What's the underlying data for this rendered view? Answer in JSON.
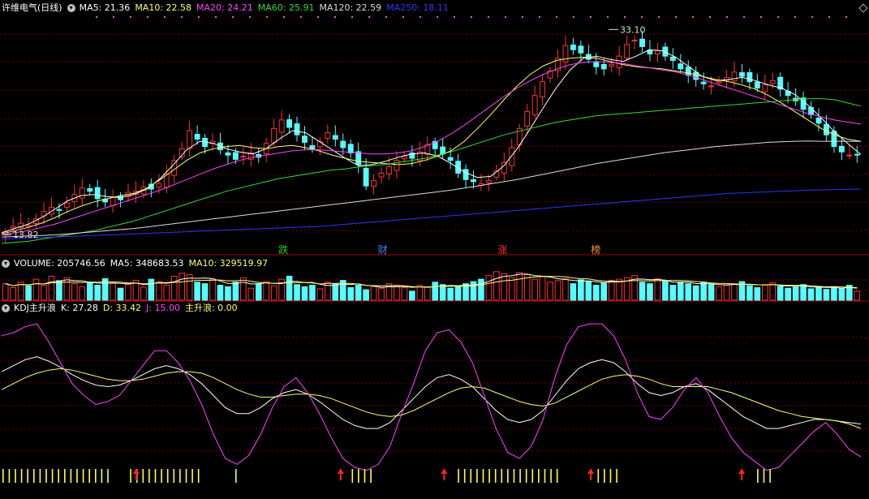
{
  "stock": {
    "name": "许维电气",
    "period": "(日线)",
    "title_color": "#ffffff"
  },
  "kline": {
    "toggle": "▾",
    "ma_labels": [
      {
        "name": "MA5",
        "value": "21.36",
        "color": "#ffffff"
      },
      {
        "name": "MA10",
        "value": "22.58",
        "color": "#ffff66"
      },
      {
        "name": "MA20",
        "value": "24.21",
        "color": "#ff44ff"
      },
      {
        "name": "MA60",
        "value": "25.91",
        "color": "#33dd33"
      },
      {
        "name": "MA120",
        "value": "22.59",
        "color": "#dddddd"
      },
      {
        "name": "MA250",
        "value": "18.11",
        "color": "#3333ff"
      }
    ],
    "high_label": "33.10",
    "low_label": "13.82",
    "event_markers": [
      {
        "text": "跌",
        "color": "#22cc22",
        "pos": 0.323
      },
      {
        "text": "财",
        "color": "#4488ff",
        "pos": 0.438
      },
      {
        "text": "涨",
        "color": "#ff3333",
        "pos": 0.577
      },
      {
        "text": "榜",
        "color": "#ff9933",
        "pos": 0.685
      }
    ]
  },
  "volume": {
    "toggle": "▾",
    "labels": [
      {
        "name": "VOLUME",
        "value": "205746.56",
        "color": "#ffffff"
      },
      {
        "name": "MA5",
        "value": "348683.53",
        "color": "#ffffff"
      },
      {
        "name": "MA10",
        "value": "329519.97",
        "color": "#ffff66"
      }
    ]
  },
  "kdj": {
    "toggle": "▾",
    "indicator_name": "KDJ主升浪",
    "labels": [
      {
        "name": "K",
        "value": "27.28",
        "color": "#ffffff"
      },
      {
        "name": "D",
        "value": "33.42",
        "color": "#ffff66"
      },
      {
        "name": "J",
        "value": "15.00",
        "color": "#ff44ff"
      },
      {
        "name": "主升浪",
        "value": "0.00",
        "color": "#ffff66"
      }
    ]
  },
  "colors": {
    "up": "#ff3333",
    "down": "#54ffff",
    "grid": "#7a0000",
    "bg": "#000000"
  },
  "chart_data": {
    "type": "line",
    "candles_close": [
      14.1,
      14.6,
      14.9,
      14.7,
      15.3,
      16.0,
      16.4,
      16.1,
      16.8,
      17.6,
      18.2,
      17.9,
      17.2,
      16.9,
      17.3,
      17.1,
      17.8,
      17.9,
      18.3,
      18.1,
      18.6,
      19.5,
      20.8,
      21.9,
      23.6,
      22.8,
      22.1,
      22.6,
      21.8,
      21.3,
      20.9,
      21.2,
      21.5,
      21.1,
      22.4,
      23.8,
      24.6,
      23.9,
      23.2,
      22.5,
      21.9,
      22.6,
      23.4,
      22.8,
      22.0,
      21.5,
      20.4,
      18.4,
      18.9,
      19.6,
      20.2,
      20.8,
      21.2,
      21.0,
      21.6,
      22.3,
      21.9,
      21.4,
      20.8,
      19.6,
      19.0,
      18.8,
      18.6,
      18.9,
      19.8,
      20.6,
      22.0,
      23.8,
      25.4,
      26.9,
      28.2,
      29.2,
      30.4,
      31.6,
      31.2,
      30.9,
      30.3,
      29.6,
      29.4,
      29.8,
      30.6,
      31.7,
      32.1,
      31.5,
      30.8,
      31.1,
      30.6,
      30.2,
      29.4,
      28.8,
      28.4,
      28.0,
      27.8,
      28.2,
      28.6,
      29.1,
      28.7,
      28.2,
      27.6,
      27.9,
      28.3,
      27.5,
      26.9,
      26.4,
      25.6,
      25.1,
      24.3,
      23.2,
      22.1,
      21.6,
      21.3,
      21.36
    ],
    "ma_series": [
      {
        "name": "MA5",
        "color": "#ffffff",
        "values": [
          14.0,
          14.4,
          14.8,
          15.4,
          16.2,
          17.0,
          17.5,
          17.6,
          17.4,
          17.3,
          17.6,
          18.1,
          19.1,
          20.4,
          21.8,
          22.6,
          22.4,
          21.9,
          21.6,
          21.4,
          21.9,
          22.8,
          23.6,
          23.4,
          22.6,
          21.8,
          21.0,
          20.3,
          20.4,
          20.7,
          21.1,
          21.4,
          21.5,
          21.2,
          20.5,
          19.7,
          19.2,
          19.3,
          20.3,
          21.9,
          23.8,
          25.8,
          27.7,
          29.3,
          30.4,
          30.6,
          30.3,
          30.1,
          30.6,
          31.2,
          31.1,
          30.5,
          29.6,
          28.7,
          28.3,
          28.4,
          28.6,
          28.3,
          27.9,
          27.6,
          27.0,
          26.0,
          24.8,
          23.5,
          22.4,
          21.36
        ]
      },
      {
        "name": "MA10",
        "color": "#ffff66",
        "values": [
          13.9,
          14.2,
          14.5,
          14.9,
          15.4,
          16.0,
          16.5,
          16.9,
          17.2,
          17.5,
          17.7,
          18.2,
          19.0,
          19.9,
          20.8,
          21.5,
          21.9,
          22.1,
          22.2,
          22.0,
          21.9,
          22.1,
          22.2,
          22.0,
          21.7,
          21.3,
          21.0,
          20.7,
          20.6,
          20.5,
          20.4,
          20.5,
          20.8,
          21.2,
          21.7,
          22.6,
          23.8,
          25.1,
          26.5,
          27.8,
          28.9,
          29.7,
          30.2,
          30.4,
          30.5,
          30.4,
          30.1,
          29.8,
          29.6,
          29.5,
          29.4,
          29.2,
          29.0,
          28.7,
          28.4,
          28.2,
          27.9,
          27.5,
          26.9,
          26.2,
          25.4,
          24.6,
          23.8,
          23.2,
          22.8,
          22.58
        ]
      },
      {
        "name": "MA20",
        "color": "#ff44ff",
        "values": [
          13.8,
          14.0,
          14.2,
          14.5,
          14.8,
          15.2,
          15.6,
          16.0,
          16.4,
          16.8,
          17.2,
          17.6,
          18.0,
          18.5,
          19.0,
          19.5,
          20.0,
          20.4,
          20.8,
          21.1,
          21.3,
          21.5,
          21.7,
          21.8,
          21.8,
          21.7,
          21.6,
          21.5,
          21.4,
          21.4,
          21.5,
          21.7,
          22.1,
          22.6,
          23.3,
          24.1,
          25.0,
          25.9,
          26.8,
          27.6,
          28.3,
          28.9,
          29.4,
          29.8,
          30.0,
          30.1,
          30.0,
          29.9,
          29.7,
          29.5,
          29.3,
          29.1,
          28.8,
          28.4,
          28.0,
          27.6,
          27.2,
          26.8,
          26.4,
          26.0,
          25.6,
          25.2,
          24.9,
          24.6,
          24.4,
          24.21
        ]
      },
      {
        "name": "MA60",
        "color": "#33dd33",
        "values": [
          13.0,
          13.1,
          13.2,
          13.4,
          13.6,
          13.8,
          14.0,
          14.2,
          14.5,
          14.8,
          15.1,
          15.5,
          15.9,
          16.3,
          16.7,
          17.1,
          17.5,
          17.9,
          18.2,
          18.5,
          18.8,
          19.1,
          19.3,
          19.5,
          19.7,
          19.9,
          20.0,
          20.2,
          20.3,
          20.4,
          20.6,
          20.8,
          21.0,
          21.3,
          21.6,
          22.0,
          22.4,
          22.8,
          23.2,
          23.5,
          23.8,
          24.1,
          24.4,
          24.6,
          24.8,
          25.0,
          25.1,
          25.2,
          25.3,
          25.4,
          25.5,
          25.6,
          25.7,
          25.8,
          25.9,
          26.0,
          26.1,
          26.2,
          26.3,
          26.4,
          26.5,
          26.6,
          26.6,
          26.5,
          26.2,
          25.91
        ]
      },
      {
        "name": "MA120",
        "color": "#dddddd",
        "values": [
          13.6,
          13.65,
          13.7,
          13.75,
          13.8,
          13.9,
          14.0,
          14.1,
          14.2,
          14.3,
          14.4,
          14.55,
          14.7,
          14.85,
          15.0,
          15.15,
          15.3,
          15.45,
          15.6,
          15.75,
          15.9,
          16.05,
          16.2,
          16.35,
          16.5,
          16.65,
          16.8,
          16.95,
          17.1,
          17.25,
          17.4,
          17.55,
          17.7,
          17.85,
          18.0,
          18.2,
          18.4,
          18.6,
          18.8,
          19.0,
          19.25,
          19.5,
          19.75,
          20.0,
          20.25,
          20.5,
          20.7,
          20.9,
          21.1,
          21.3,
          21.5,
          21.65,
          21.8,
          21.95,
          22.1,
          22.2,
          22.3,
          22.4,
          22.5,
          22.55,
          22.6,
          22.62,
          22.6,
          22.6,
          22.6,
          22.59
        ]
      },
      {
        "name": "MA250",
        "color": "#3333ff",
        "values": [
          13.4,
          13.45,
          13.5,
          13.55,
          13.6,
          13.65,
          13.7,
          13.75,
          13.8,
          13.85,
          13.9,
          13.95,
          14.0,
          14.05,
          14.1,
          14.15,
          14.2,
          14.25,
          14.3,
          14.35,
          14.4,
          14.45,
          14.5,
          14.55,
          14.6,
          14.7,
          14.8,
          14.9,
          15.0,
          15.1,
          15.2,
          15.3,
          15.4,
          15.5,
          15.6,
          15.7,
          15.8,
          15.9,
          16.0,
          16.1,
          16.2,
          16.3,
          16.4,
          16.5,
          16.6,
          16.7,
          16.8,
          16.9,
          17.0,
          17.1,
          17.2,
          17.3,
          17.4,
          17.5,
          17.6,
          17.7,
          17.75,
          17.8,
          17.85,
          17.9,
          17.95,
          18.0,
          18.03,
          18.06,
          18.09,
          18.11
        ]
      }
    ],
    "ylim": [
      13.0,
      34.5
    ],
    "volume_values": [
      0.55,
      0.42,
      0.6,
      0.48,
      0.7,
      0.5,
      0.8,
      0.65,
      0.75,
      0.55,
      0.45,
      0.6,
      0.5,
      0.72,
      0.58,
      0.4,
      0.52,
      0.66,
      0.44,
      0.7,
      0.62,
      0.5,
      0.8,
      0.9,
      0.85,
      0.6,
      0.55,
      0.7,
      0.5,
      0.45,
      0.6,
      0.75,
      0.4,
      0.55,
      0.62,
      0.48,
      0.7,
      0.8,
      0.52,
      0.45,
      0.5,
      0.38,
      0.6,
      0.55,
      0.66,
      0.42,
      0.5,
      0.35,
      0.45,
      0.4,
      0.55,
      0.48,
      0.42,
      0.3,
      0.5,
      0.45,
      0.6,
      0.52,
      0.4,
      0.45,
      0.55,
      0.62,
      0.7,
      0.82,
      0.95,
      0.88,
      0.75,
      0.92,
      0.85,
      0.7,
      0.78,
      0.6,
      0.65,
      0.72,
      0.55,
      0.68,
      0.62,
      0.5,
      0.58,
      0.66,
      0.7,
      0.75,
      0.82,
      0.6,
      0.55,
      0.72,
      0.65,
      0.5,
      0.6,
      0.55,
      0.48,
      0.6,
      0.52,
      0.45,
      0.5,
      0.55,
      0.62,
      0.48,
      0.42,
      0.5,
      0.58,
      0.46,
      0.4,
      0.45,
      0.52,
      0.38,
      0.42,
      0.36,
      0.45,
      0.4,
      0.5,
      0.3
    ],
    "kdj": {
      "ylim": [
        -5,
        110
      ],
      "K": [
        72,
        76,
        80,
        82,
        79,
        75,
        70,
        66,
        63,
        62,
        63,
        66,
        70,
        74,
        76,
        74,
        70,
        64,
        56,
        48,
        44,
        44,
        48,
        54,
        58,
        60,
        57,
        52,
        46,
        40,
        36,
        34,
        34,
        38,
        46,
        54,
        62,
        68,
        70,
        67,
        62,
        54,
        46,
        40,
        38,
        40,
        46,
        56,
        66,
        74,
        78,
        80,
        78,
        72,
        64,
        58,
        56,
        58,
        62,
        64,
        60,
        54,
        48,
        42,
        38,
        34,
        34,
        36,
        38,
        40,
        40,
        39,
        38,
        37
      ],
      "D": [
        60,
        64,
        68,
        71,
        73,
        74,
        73,
        71,
        69,
        67,
        66,
        66,
        67,
        69,
        71,
        72,
        72,
        71,
        68,
        64,
        60,
        57,
        55,
        55,
        56,
        57,
        57,
        56,
        54,
        51,
        48,
        45,
        43,
        42,
        43,
        46,
        50,
        54,
        58,
        61,
        62,
        61,
        58,
        55,
        52,
        50,
        49,
        51,
        55,
        59,
        63,
        67,
        69,
        70,
        69,
        67,
        64,
        62,
        62,
        62,
        62,
        60,
        58,
        55,
        52,
        49,
        46,
        44,
        42,
        41,
        40,
        39,
        37,
        34
      ],
      "J": [
        96,
        98,
        102,
        104,
        92,
        78,
        64,
        56,
        50,
        52,
        56,
        66,
        76,
        86,
        86,
        78,
        66,
        50,
        30,
        14,
        10,
        16,
        30,
        48,
        62,
        68,
        58,
        44,
        28,
        14,
        8,
        6,
        10,
        22,
        44,
        64,
        86,
        98,
        100,
        92,
        78,
        56,
        34,
        18,
        14,
        22,
        40,
        68,
        90,
        102,
        104,
        104,
        96,
        80,
        58,
        42,
        40,
        48,
        60,
        68,
        58,
        42,
        28,
        18,
        12,
        6,
        8,
        16,
        24,
        32,
        38,
        30,
        20,
        15
      ]
    },
    "main_wave_signal_positions": [
      0.158,
      0.395,
      0.515,
      0.685,
      0.86
    ]
  }
}
